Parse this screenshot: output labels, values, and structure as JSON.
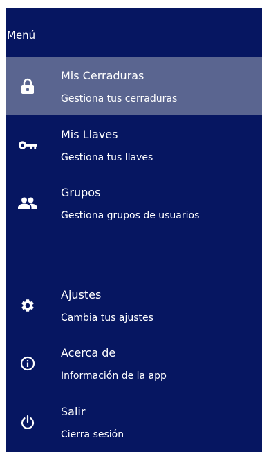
{
  "drawer": {
    "title": "Menú",
    "background_color": "#061661",
    "active_color": "#5a6590"
  },
  "menu": {
    "items": [
      {
        "title": "Mis Cerraduras",
        "subtitle": "Gestiona tus cerraduras",
        "icon": "lock-icon",
        "active": true
      },
      {
        "title": "Mis Llaves",
        "subtitle": "Gestiona tus llaves",
        "icon": "key-icon",
        "active": false
      },
      {
        "title": "Grupos",
        "subtitle": "Gestiona grupos de usuarios",
        "icon": "group-icon",
        "active": false
      },
      {
        "title": "Ajustes",
        "subtitle": "Cambia tus ajustes",
        "icon": "gear-icon",
        "active": false
      },
      {
        "title": "Acerca de",
        "subtitle": "Información de la app",
        "icon": "info-icon",
        "active": false
      },
      {
        "title": "Salir",
        "subtitle": "Cierra sesión",
        "icon": "power-icon",
        "active": false
      }
    ]
  }
}
